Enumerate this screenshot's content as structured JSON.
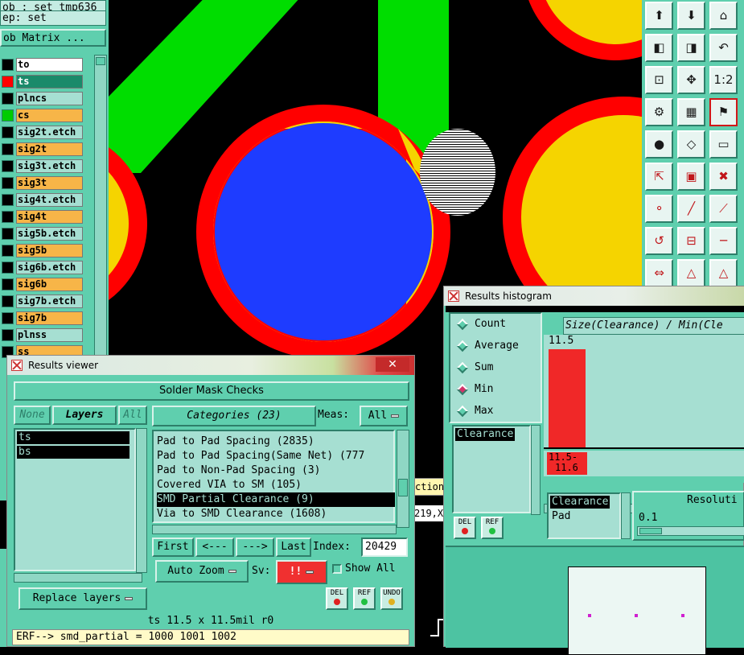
{
  "left_panel": {
    "job_line": "ob : set_tmp636",
    "step_line": "ep: set",
    "matrix_button": "ob Matrix ...",
    "layers": [
      {
        "name": "to",
        "color": "#ffffff",
        "swatch": "#000000"
      },
      {
        "name": "ts",
        "color": "#1a8a6a",
        "swatch": "#ff0000",
        "active": true
      },
      {
        "name": "plncs",
        "color": "#a6dfd2",
        "swatch": "#000000"
      },
      {
        "name": "cs",
        "color": "#f7b548",
        "swatch": "#00cc00"
      },
      {
        "name": "sig2t.etch",
        "color": "#a6dfd2",
        "swatch": "#000000"
      },
      {
        "name": "sig2t",
        "color": "#f7b548",
        "swatch": "#000000"
      },
      {
        "name": "sig3t.etch",
        "color": "#a6dfd2",
        "swatch": "#000000"
      },
      {
        "name": "sig3t",
        "color": "#f7b548",
        "swatch": "#000000"
      },
      {
        "name": "sig4t.etch",
        "color": "#a6dfd2",
        "swatch": "#000000"
      },
      {
        "name": "sig4t",
        "color": "#f7b548",
        "swatch": "#000000"
      },
      {
        "name": "sig5b.etch",
        "color": "#a6dfd2",
        "swatch": "#000000"
      },
      {
        "name": "sig5b",
        "color": "#f7b548",
        "swatch": "#000000"
      },
      {
        "name": "sig6b.etch",
        "color": "#a6dfd2",
        "swatch": "#000000"
      },
      {
        "name": "sig6b",
        "color": "#f7b548",
        "swatch": "#000000"
      },
      {
        "name": "sig7b.etch",
        "color": "#a6dfd2",
        "swatch": "#000000"
      },
      {
        "name": "sig7b",
        "color": "#f7b548",
        "swatch": "#000000"
      },
      {
        "name": "plnss",
        "color": "#a6dfd2",
        "swatch": "#000000"
      },
      {
        "name": "ss",
        "color": "#f7b548",
        "swatch": "#000000"
      }
    ]
  },
  "canvas": {
    "colors": {
      "background": "#000000",
      "trace": "#00dd00",
      "pad": "#f5d400",
      "mask": "#ff0000",
      "via": "#1e3cff"
    }
  },
  "tool_palette": {
    "icons": [
      "move-up-icon",
      "move-down-icon",
      "home-icon",
      "move-left-icon",
      "move-right-icon",
      "undo-move-icon",
      "fit-icon",
      "zoom-center-icon",
      "scale-1-2-icon",
      "settings-icon",
      "grid-icon",
      "layers-toggle-icon",
      "add-pad-icon",
      "polygon-icon",
      "ruler-icon",
      "snap-icon",
      "move-pad-icon",
      "delete-icon",
      "connect-icon",
      "line-icon",
      "line-angle-icon",
      "arc-icon",
      "pad-snap-icon",
      "cut-line-icon",
      "measure-icon",
      "triangle-icon",
      "triangle-outline-icon",
      "triangle-filled-icon"
    ]
  },
  "results_viewer": {
    "window_title": "Results viewer",
    "heading": "Solder Mask Checks",
    "none_btn": "None",
    "layers_label": "Layers",
    "all_btn": "All",
    "layers": [
      "ts",
      "bs"
    ],
    "categories_label": "Categories (23)",
    "meas_label": "Meas:",
    "meas_value": "All",
    "categories": [
      "Pad to Pad Spacing (2835)",
      "Pad to Pad Spacing(Same Net) (777",
      "Pad to Non-Pad Spacing (3)",
      "Covered VIA to SM (105)",
      "SMD Partial Clearance (9)",
      "Via to SMD Clearance (1608)"
    ],
    "selected_category": 4,
    "first_btn": "First",
    "prev_btn": "<---",
    "next_btn": "--->",
    "last_btn": "Last",
    "index_label": "Index:",
    "index_value": "20429",
    "auto_zoom": "Auto Zoom",
    "sv_label": "Sv:",
    "sv_value": "!!",
    "show_all": "Show All",
    "replace_layers": "Replace layers",
    "del_btn": "DEL",
    "ref_btn": "REF",
    "undo_btn": "UNDO",
    "status": "ts  11.5 x 11.5mil  r0",
    "erf": "ERF--> smd_partial = 1000 1001 1002"
  },
  "behind_text": {
    "ction": "ction",
    "coord": "219,X"
  },
  "histogram": {
    "window_title": "Results histogram",
    "modes": [
      "Count",
      "Average",
      "Sum",
      "Min",
      "Max"
    ],
    "selected_mode": "Min",
    "chart_title": "Size(Clearance) / Min(Cle",
    "bar_value": "11.5",
    "bin_label_1": "11.5-",
    "bin_label_2": "11.6",
    "measure_items": [
      "Clearance"
    ],
    "type_items": [
      "Clearance",
      "Pad"
    ],
    "resolution_label": "Resoluti",
    "resolution_value": "0.1",
    "del_btn": "DEL",
    "ref_btn": "REF"
  },
  "chart_data": {
    "type": "bar",
    "title": "Size(Clearance) / Min(Cle",
    "categories": [
      "11.5-11.6"
    ],
    "values": [
      11.5
    ],
    "bar_label": "11.5"
  }
}
